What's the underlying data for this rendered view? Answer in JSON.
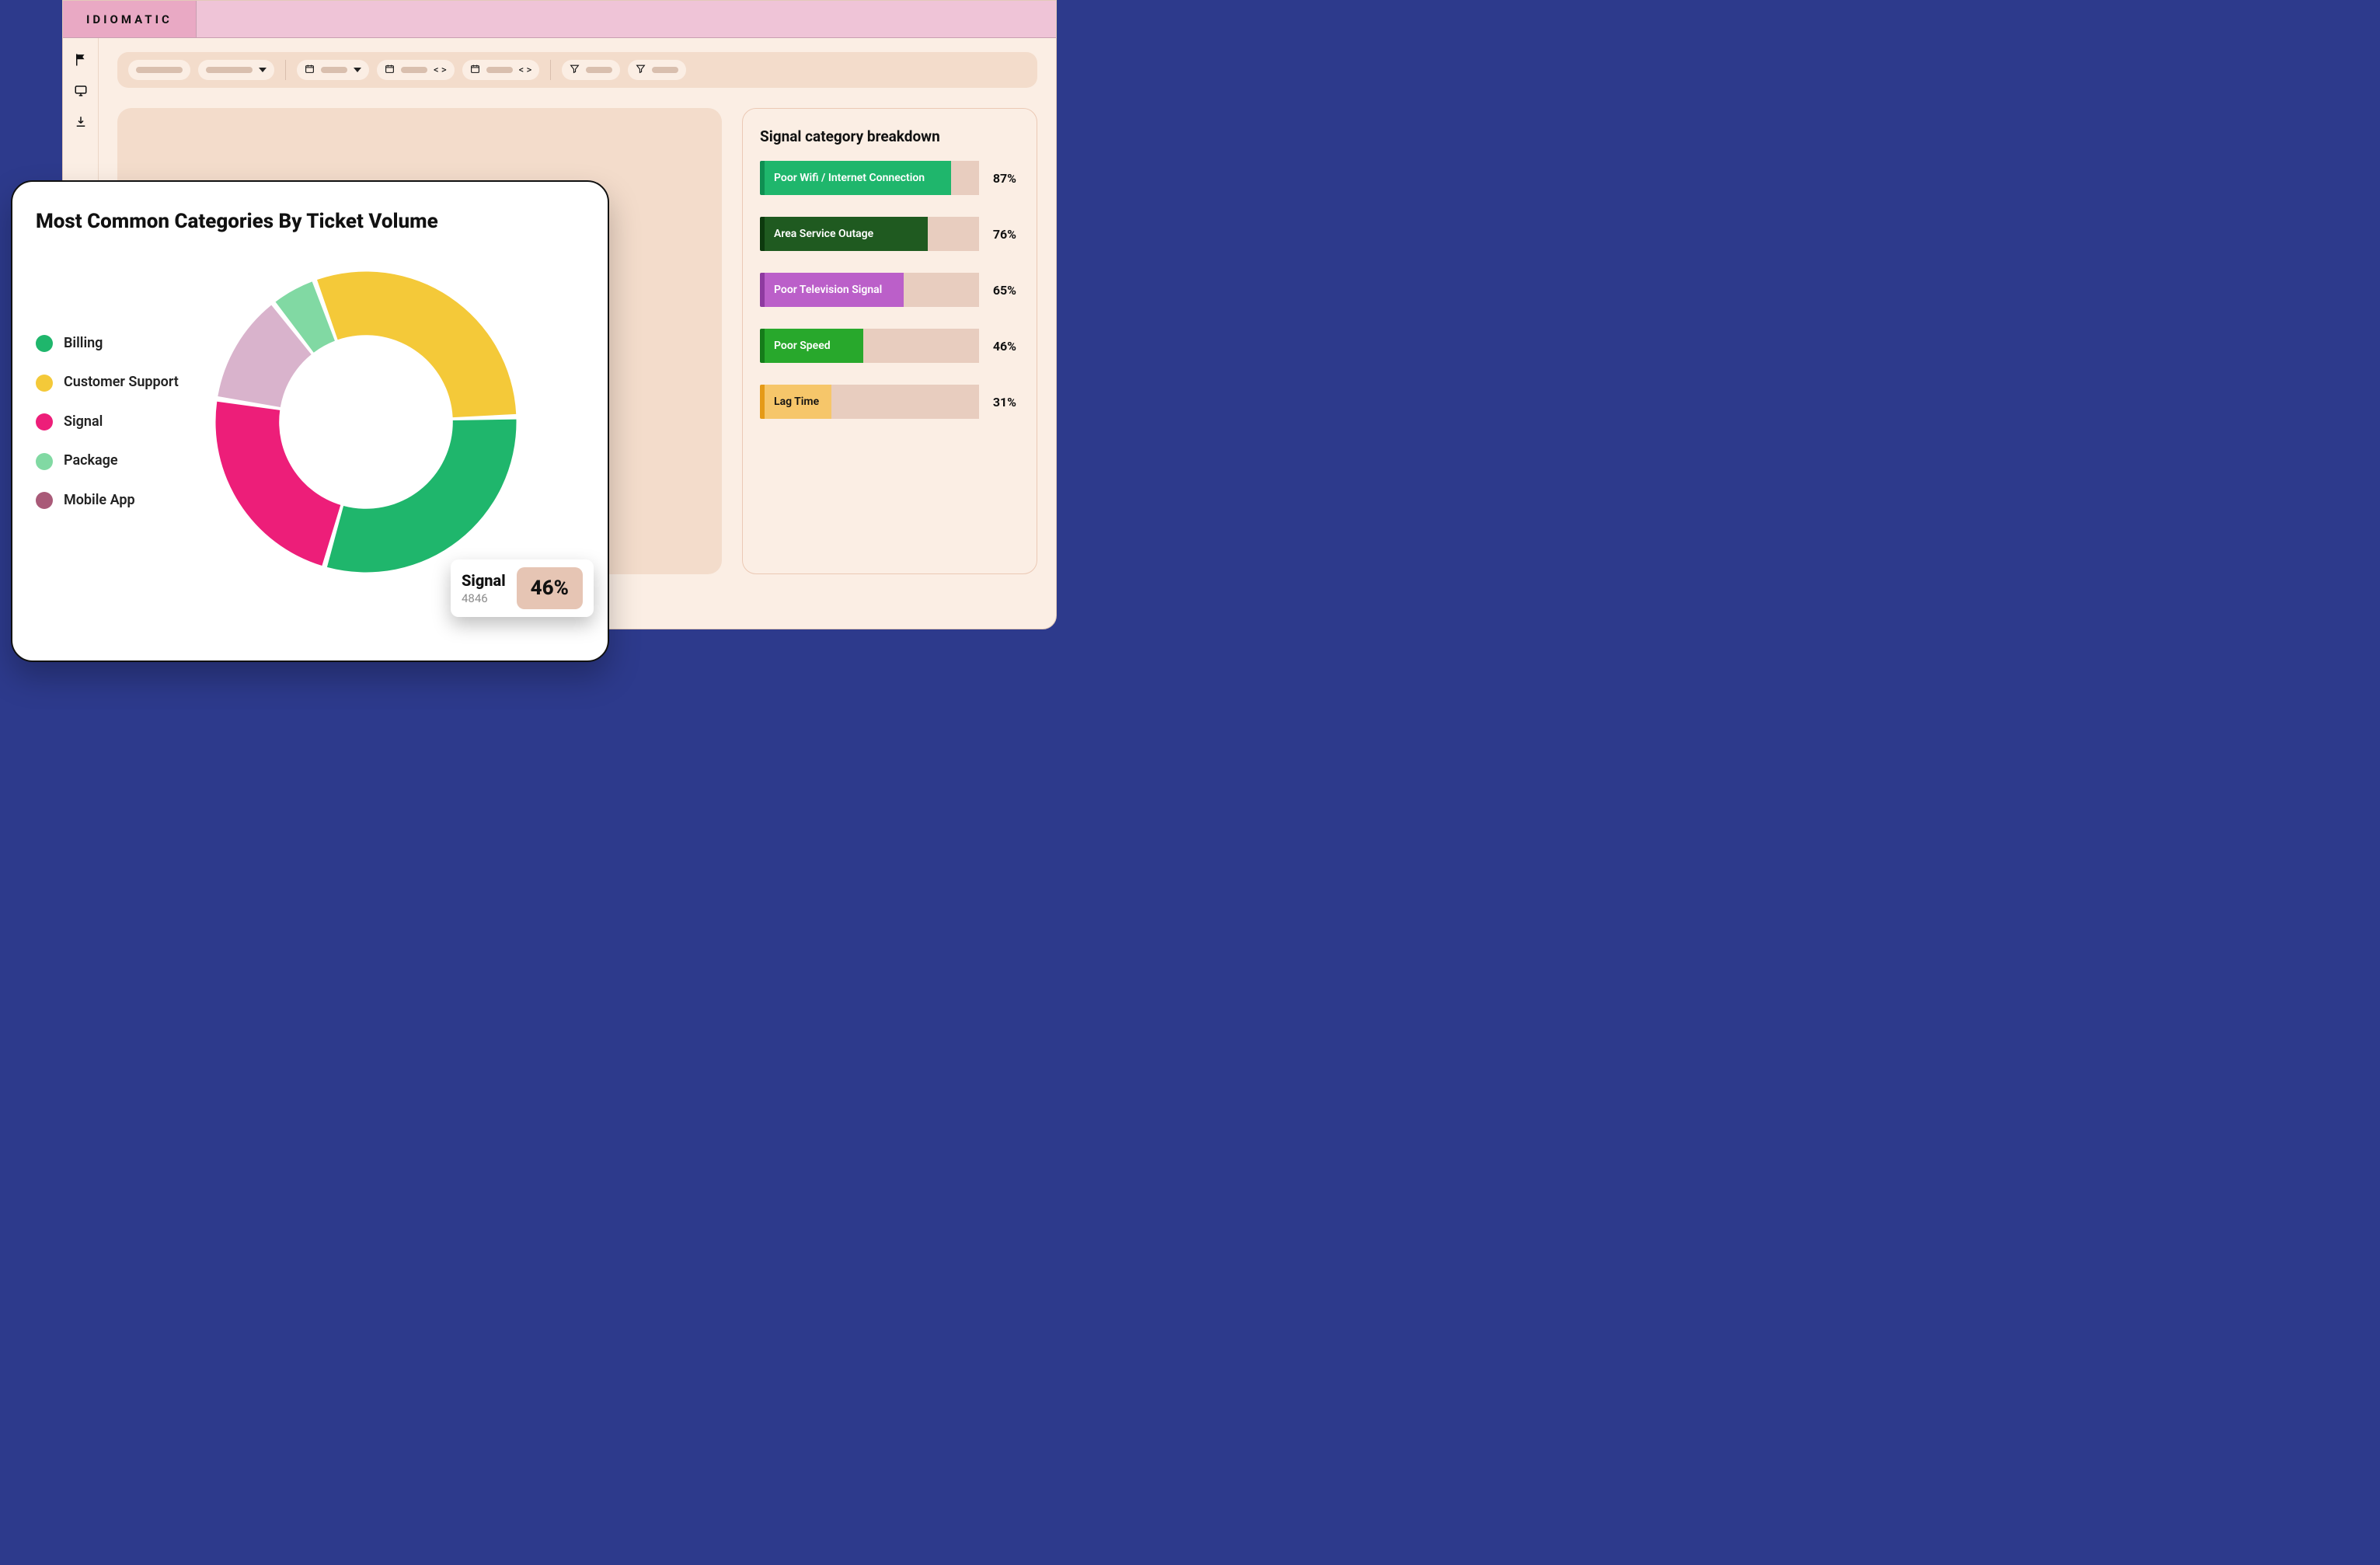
{
  "brand": "IDIOMATIC",
  "chart_data": [
    {
      "type": "pie",
      "title": "Most Common Categories By Ticket Volume",
      "series": [
        {
          "name": "Billing",
          "value": 30,
          "color": "#1fb66c"
        },
        {
          "name": "Customer Support",
          "value": 30,
          "color": "#f4c939"
        },
        {
          "name": "Signal",
          "value": 23,
          "color": "#ed1e79"
        },
        {
          "name": "Package",
          "value": 5,
          "color": "#81d9a3"
        },
        {
          "name": "Mobile App",
          "value": 12,
          "color": "#d9b3cc"
        }
      ],
      "legend": [
        {
          "label": "Billing",
          "color": "#1fb66c"
        },
        {
          "label": "Customer Support",
          "color": "#f4c939"
        },
        {
          "label": "Signal",
          "color": "#ed1e79"
        },
        {
          "label": "Package",
          "color": "#81d9a3"
        },
        {
          "label": "Mobile App",
          "color": "#a95a78"
        }
      ],
      "tooltip": {
        "name": "Signal",
        "count": "4846",
        "pct": "46%"
      }
    },
    {
      "type": "bar",
      "title": "Signal category breakdown",
      "categories": [
        "Poor Wifi / Internet Connection",
        "Area Service Outage",
        "Poor Television Signal",
        "Poor Speed",
        "Lag Time"
      ],
      "values": [
        87,
        76,
        65,
        46,
        31
      ],
      "value_labels": [
        "87%",
        "76%",
        "65%",
        "46%",
        "31%"
      ],
      "xlim": [
        0,
        100
      ],
      "series_colors": [
        "#1fb66c",
        "#1f5a20",
        "#bb5fc9",
        "#28a82c",
        "#f6c66a"
      ],
      "edge_colors": [
        "#0f8f52",
        "#0d3a0e",
        "#8e3aa0",
        "#157c1a",
        "#e59a17"
      ],
      "dark_label": [
        false,
        false,
        false,
        false,
        true
      ]
    }
  ]
}
